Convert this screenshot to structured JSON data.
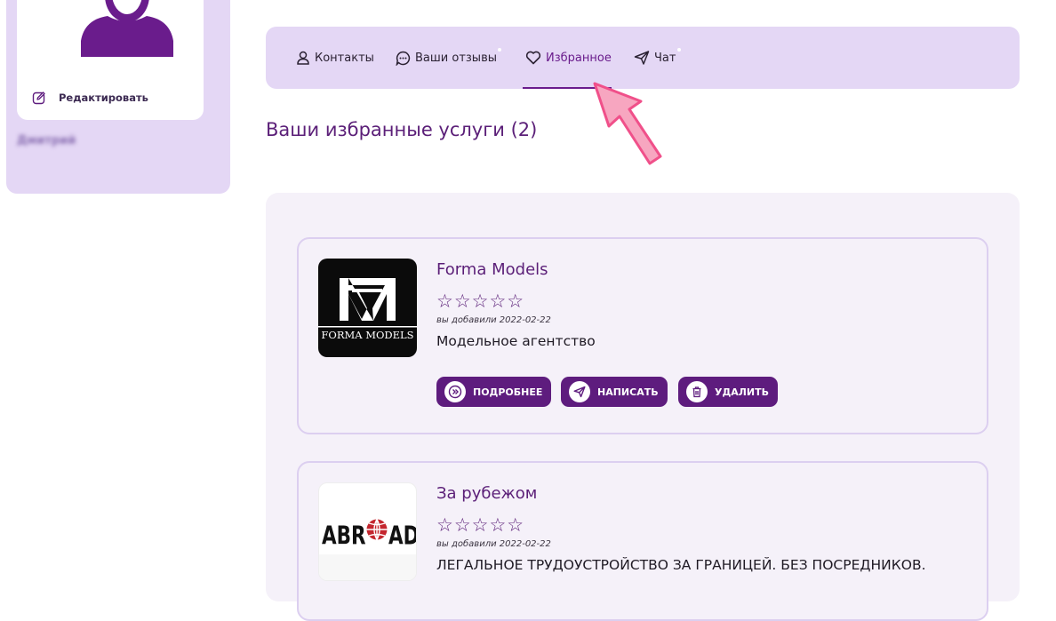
{
  "sidebar": {
    "edit_label": "Редактировать",
    "user_name": "Дмитрий"
  },
  "tabs": [
    {
      "label": "Контакты",
      "icon": "user-icon"
    },
    {
      "label": "Ваши отзывы",
      "icon": "comment-icon"
    },
    {
      "label": "Избранное",
      "icon": "heart-icon",
      "active": true
    },
    {
      "label": "Чат",
      "icon": "send-icon"
    }
  ],
  "page_title": "Ваши избранные услуги (2)",
  "favorites": [
    {
      "name": "Forma Models",
      "rating": 0,
      "stars": "☆☆☆☆☆",
      "added": "вы добавили 2022-02-22",
      "description": "Модельное агентство",
      "logo_text": "FORMA MODELS"
    },
    {
      "name": "За рубежом",
      "rating": 0,
      "stars": "☆☆☆☆☆",
      "added": "вы добавили 2022-02-22",
      "description": "ЛЕГАЛЬНОЕ ТРУДОУСТРОЙСТВО ЗА ГРАНИЦЕЙ. БЕЗ ПОСРЕДНИКОВ.",
      "logo_text_left": "ABR",
      "logo_text_right": "AD"
    }
  ],
  "buttons": {
    "details": "ПОДРОБНЕЕ",
    "write": "НАПИСАТЬ",
    "delete": "УДАЛИТЬ"
  },
  "colors": {
    "accent": "#5e1c7e",
    "panel": "#e4d7f5",
    "title": "#5b1f78",
    "arrow": "#f0508a"
  }
}
